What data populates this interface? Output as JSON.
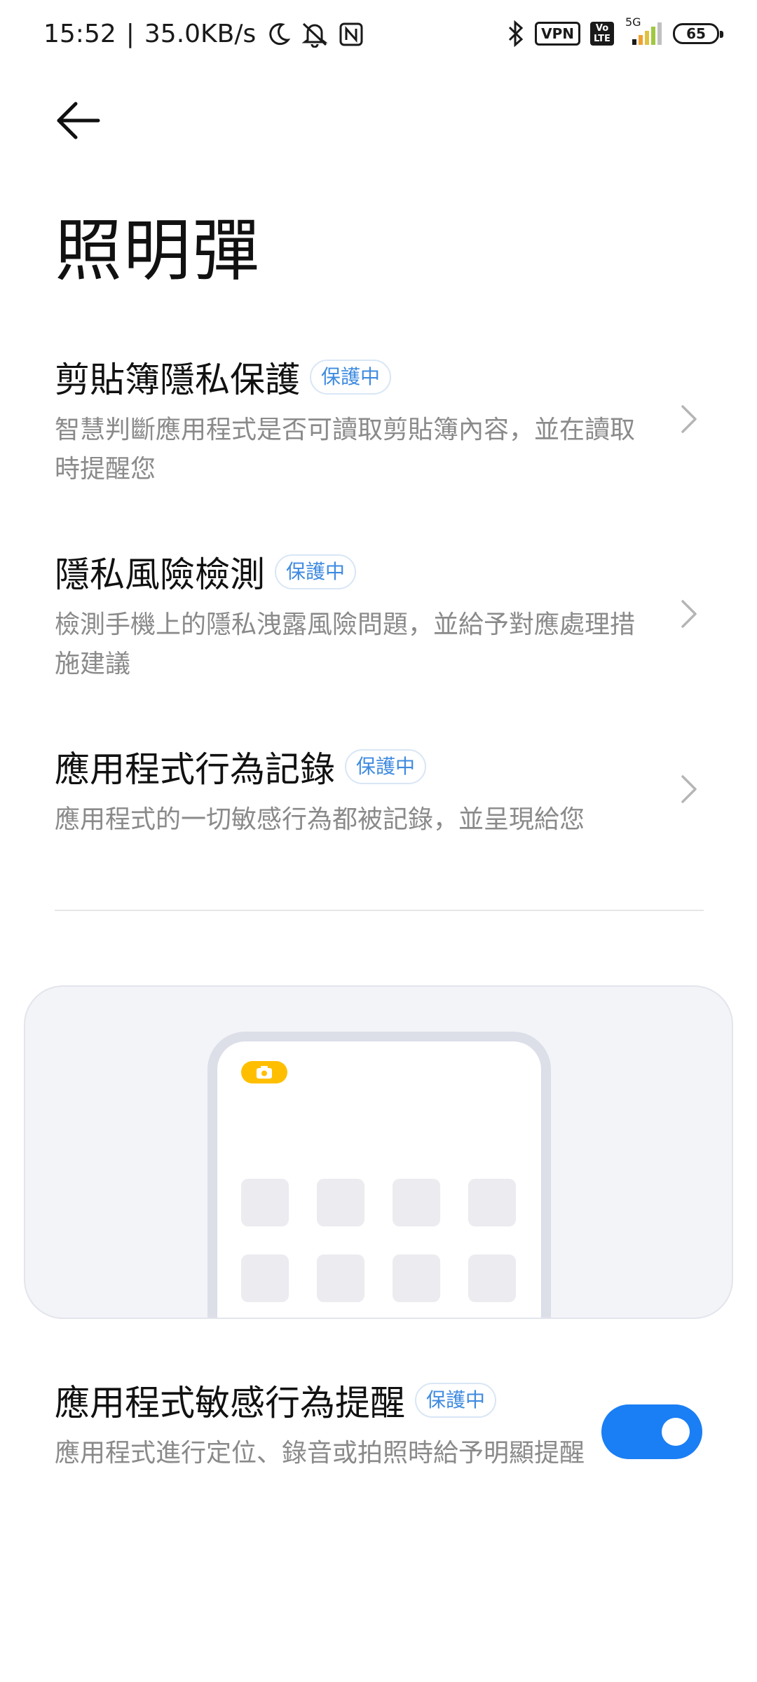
{
  "status_bar": {
    "time": "15:52",
    "separator": "|",
    "net_speed": "35.0KB/s",
    "vpn": "VPN",
    "volte": "Vo LTE",
    "signal_label": "5G",
    "battery": "65",
    "icons": [
      "moon-icon",
      "mute-bell-icon",
      "nfc-icon",
      "bluetooth-icon",
      "signal-icon"
    ]
  },
  "header": {
    "title": "照明彈"
  },
  "items": [
    {
      "title": "剪貼簿隱私保護",
      "badge": "保護中",
      "desc": "智慧判斷應用程式是否可讀取剪貼簿內容，並在讀取時提醒您"
    },
    {
      "title": "隱私風險檢測",
      "badge": "保護中",
      "desc": "檢測手機上的隱私洩露風險問題，並給予對應處理措施建議"
    },
    {
      "title": "應用程式行為記錄",
      "badge": "保護中",
      "desc": "應用程式的一切敏感行為都被記錄，並呈現給您"
    }
  ],
  "sensitive": {
    "title": "應用程式敏感行為提醒",
    "badge": "保護中",
    "desc": "應用程式進行定位、錄音或拍照時給予明顯提醒",
    "enabled": true
  },
  "colors": {
    "accent": "#1a7ef4",
    "badge_text": "#3f8be0",
    "camera_pill": "#ffbf00"
  }
}
